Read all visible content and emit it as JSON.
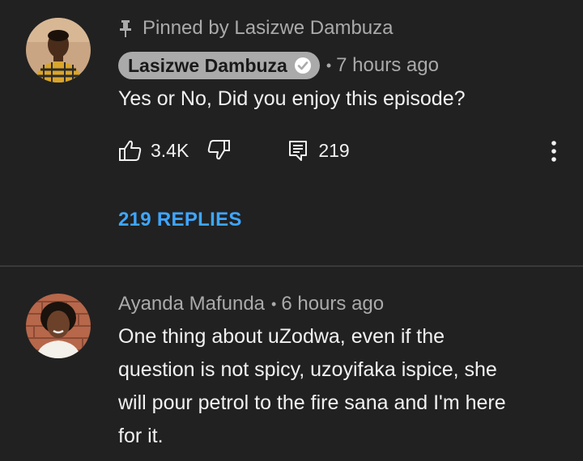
{
  "pinned_comment": {
    "pinned_label": "Pinned by Lasizwe Dambuza",
    "author": "Lasizwe Dambuza",
    "time": "7 hours ago",
    "text": "Yes or No, Did you enjoy this episode?",
    "likes": "3.4K",
    "reply_count": "219",
    "view_replies_label": "219 REPLIES",
    "icons": {
      "pin": "pin-icon",
      "verified": "verified-check-icon",
      "like": "thumbs-up-icon",
      "dislike": "thumbs-down-icon",
      "reply": "comment-icon",
      "more": "more-vert-icon"
    }
  },
  "second_comment": {
    "author": "Ayanda Mafunda",
    "time": "6 hours ago",
    "text_lines": [
      "One thing about uZodwa, even if the",
      "question is not spicy, uzoyifaka ispice, she",
      "will pour petrol to the fire sana and I'm here",
      "for it."
    ]
  },
  "colors": {
    "background": "#212121",
    "primary_text": "#f1f1f1",
    "secondary_text": "#aaaaaa",
    "link_blue": "#3ea6ff",
    "author_chip": "#aaaaaa"
  }
}
